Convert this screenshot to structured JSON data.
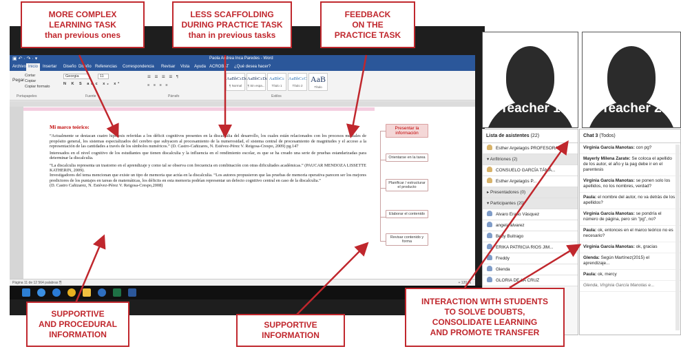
{
  "word": {
    "quick_access": "▣ ↶ · ↷ · ▾",
    "window_title": "Paola Andrea Inca Paredes - Word",
    "tabs": [
      "Archivo",
      "Inicio",
      "Insertar",
      "Diseño",
      "Diseño",
      "Referencias",
      "Correspondencia",
      "Revisar",
      "Vista",
      "Ayuda",
      "ACROBAT",
      "¿Qué desea hacer?"
    ],
    "ribbon": {
      "paste": "Pegar",
      "cut": "Cortar",
      "copy": "Copiar",
      "format_painter": "Copiar formato",
      "font_name": "Georgia",
      "font_size": "11",
      "groups": [
        "Portapapeles",
        "Fuente",
        "Párrafo",
        "Estilos"
      ],
      "styles": [
        {
          "sample": "AaBbCcDc",
          "name": "¶ Normal"
        },
        {
          "sample": "AaBbCcDc",
          "name": "¶ Sin espa..."
        },
        {
          "sample": "AaBbCc",
          "name": "Título 1"
        },
        {
          "sample": "AaBbCcC",
          "name": "Título 2"
        },
        {
          "sample": "AaB",
          "name": "Título"
        }
      ]
    },
    "doc_heading": "Mi marco teórico:",
    "doc_paragraphs": [
      "“Actualmente se destacan cuatro hipótesis referidas a los déficit cognitivos presentes en la discalculia del desarrollo, los cuales están relacionados con los procesos mentales de propósito general, los sistemas especializados del cerebro que subyacen al procesamiento de la numerosidad, el sistema central de procesamiento de magnitudes y el acceso a la representación de las cantidades a través de los símbolos numéricos.” (D. Castro-Cañizares, N. Estévez-Pérez V. Reigosa-Crespo, 2009) pg.147",
      "Interesados en el nivel cognitivo de los estudiantes que tienen discalculia y la influencia en el rendimiento escolar, es que se ha creado una serie de pruebas estandarizadas para determinar la discalculia.",
      "“La discalculia representa un trastorno en el aprendizaje y como tal se observa con frecuencia en combinación con otras dificultades académicas.” (PAUCAR MENDOZA LISSETTE KATHERIN, 2009).",
      "Investigadores del tema mencionan que existe un tipo de memoria que actúa en la discalculia. “Los autores propusieron que las pruebas de memoria operativa parecen ser los mejores predictores de los puntajes en tareas de matemáticas, los déficits en esta memoria podrían representar un defecto cognitivo central en caso de la discalculia.”",
      "(D. Castro Cañizarez, N. Estévez-Pérez V. Reigosa-Crespo,2008)"
    ],
    "side_boxes": [
      "Presentar la información",
      "Orientarse en la tarea",
      "Planificar / estructurar el producto",
      "Elaborar el contenido",
      "Revisar contenido y forma"
    ],
    "status": "Página 11 de 12    564 palabras    ⎘",
    "zoom": "+ 120 %"
  },
  "videos": [
    {
      "label": "Teacher 1"
    },
    {
      "label": "Teacher 2"
    }
  ],
  "attendees": {
    "title": "Lista de asistentes",
    "count": "(22)",
    "rows": [
      {
        "text": "Esther Argelagós PROFESORA",
        "type": "host"
      },
      {
        "text": "▾ Anfitriones (2)",
        "type": "section"
      },
      {
        "text": "CONSUELO GARCÍA TÁMA...",
        "type": "host"
      },
      {
        "text": "Esther Argelagós P...",
        "type": "host"
      },
      {
        "text": "▸ Presentadores (0)",
        "type": "section"
      },
      {
        "text": "▾ Participantes (20)",
        "type": "section"
      },
      {
        "text": "Alvaro Eraso Vásquez",
        "type": "person"
      },
      {
        "text": "angela alvarez",
        "type": "person"
      },
      {
        "text": "Betty Buitrago",
        "type": "person"
      },
      {
        "text": "ERIKA PATRICIA RIOS JIM...",
        "type": "person"
      },
      {
        "text": "Freddy",
        "type": "person"
      },
      {
        "text": "Glenda",
        "type": "person"
      },
      {
        "text": "GLORIA DE LA CRUZ",
        "type": "person"
      }
    ]
  },
  "chat": {
    "title": "Chat 3",
    "scope": "(Todos)",
    "messages": [
      {
        "author": "Virginia García Manotas:",
        "text": "con pg?"
      },
      {
        "author": "Mayerly Milena Zarate:",
        "text": "Se coloca el apellido de los autor, el año y la pag debe ir en el parentesis"
      },
      {
        "author": "Virginia García Manotas:",
        "text": "se ponen solo los apellidos, no los nombres, verdad?"
      },
      {
        "author": "Paula:",
        "text": "el nombre del autor, no va detrás de los apellidos?"
      },
      {
        "author": "Virginia García Manotas:",
        "text": "se pondría el número de página, pero sin \"pg\", no?"
      },
      {
        "author": "Paula:",
        "text": "ok, entonces en el marco teórico no es necesario?"
      },
      {
        "author": "Virginia García Manotas:",
        "text": "ok, gracias"
      },
      {
        "author": "Glenda:",
        "text": "Según Martínez(2015) el aprendizaje..."
      },
      {
        "author": "Paula:",
        "text": "ok, mercy"
      },
      {
        "author": "",
        "text": "Glenda, Virginia García Manotas e..."
      }
    ]
  },
  "callouts": {
    "complex": "MORE COMPLEX\nLEARNING TASK\nthan previous ones",
    "scaffolding": "LESS SCAFFOLDING\nDURING PRACTICE TASK\nthan in previous tasks",
    "feedback": "FEEDBACK\nON THE\nPRACTICE TASK",
    "procedural": "SUPPORTIVE\nAND PROCEDURAL\nINFORMATION",
    "supportive": "SUPPORTIVE\nINFORMATION",
    "interaction": "INTERACTION WITH STUDENTS\nTO SOLVE DOUBTS,\nCONSOLIDATE LEARNING\nAND PROMOTE TRANSFER"
  },
  "colors": {
    "callout_red": "#c0272d",
    "word_blue": "#2b579a",
    "heading_red": "#c00000"
  }
}
